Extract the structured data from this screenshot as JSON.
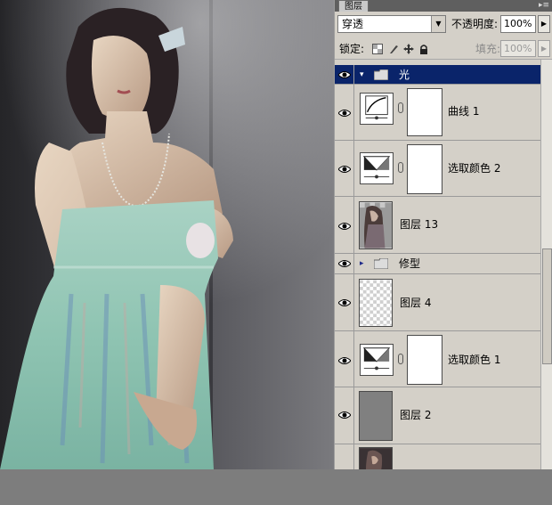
{
  "panel": {
    "tab_label": "图层",
    "menu_glyph": "▸≡"
  },
  "blend_mode": {
    "value": "穿透",
    "arrow": "▼"
  },
  "opacity": {
    "label": "不透明度:",
    "value": "100%",
    "arrow": "▶"
  },
  "lock": {
    "label": "锁定:",
    "icons": [
      "lock-transparent-icon",
      "lock-paint-icon",
      "lock-move-icon",
      "lock-all-icon"
    ]
  },
  "fill": {
    "label": "填充:",
    "value": "100%",
    "arrow": "▶"
  },
  "layers": [
    {
      "name": "光",
      "kind": "group",
      "selected": true,
      "expanded": true,
      "visible": true
    },
    {
      "name": "曲线 1",
      "kind": "adjustment-curves",
      "visible": true
    },
    {
      "name": "选取颜色 2",
      "kind": "adjustment-selective-color",
      "visible": true
    },
    {
      "name": "图层 13",
      "kind": "pixel",
      "visible": true
    },
    {
      "name": "修型",
      "kind": "group",
      "expanded": false,
      "visible": true
    },
    {
      "name": "图层 4",
      "kind": "pixel-transparent",
      "visible": true
    },
    {
      "name": "选取颜色 1",
      "kind": "adjustment-selective-color",
      "visible": true
    },
    {
      "name": "图层 2",
      "kind": "pixel-gray",
      "visible": true
    },
    {
      "name": "",
      "kind": "pixel-photo",
      "visible": true
    }
  ],
  "colors": {
    "selected_row": "#0a246a",
    "panel_bg": "#d4d0c8",
    "workspace": "#7d7d7d"
  }
}
